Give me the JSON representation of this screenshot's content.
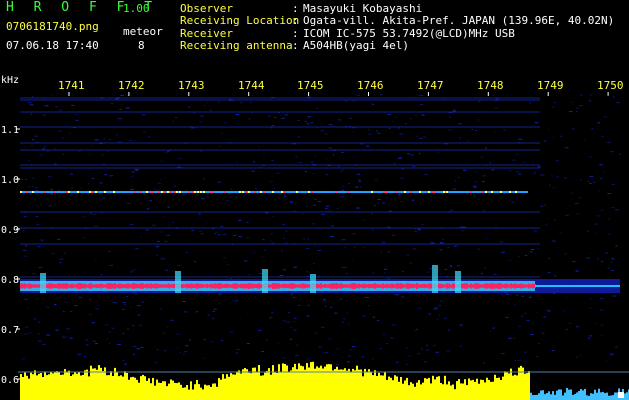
{
  "app": {
    "name": "H R O F F T",
    "version": "1.00"
  },
  "file": {
    "name": "0706181740.png",
    "datetime": "07.06.18 17:40"
  },
  "meteor": {
    "label": "meteor",
    "count": "8"
  },
  "info": [
    {
      "label": "Observer",
      "value": "Masayuki Kobayashi"
    },
    {
      "label": "Receiving Location",
      "value": "Ogata-vill. Akita-Pref. JAPAN (139.96E, 40.02N)"
    },
    {
      "label": "Receiver",
      "value": "ICOM IC-575 53.7492(@LCD)MHz USB"
    },
    {
      "label": "Receiving antenna",
      "value": "A504HB(yagi 4el)"
    }
  ],
  "plot": {
    "y_unit": "kHz",
    "y_ticks": [
      "1.1",
      "1.0",
      "0.9",
      "0.8",
      "0.7",
      "0.6"
    ],
    "time_ticks": [
      "1741",
      "1742",
      "1743",
      "1744",
      "1745",
      "1746",
      "1747",
      "1748",
      "1749",
      "1750"
    ],
    "colors": {
      "text_green": "#39ff39",
      "text_yellow": "#ffff40",
      "carrier_core": "#ff2060",
      "signal_cyan": "#40e0ff",
      "noise_blue": "#1830ff",
      "level_yellow": "#ffff00"
    }
  }
}
